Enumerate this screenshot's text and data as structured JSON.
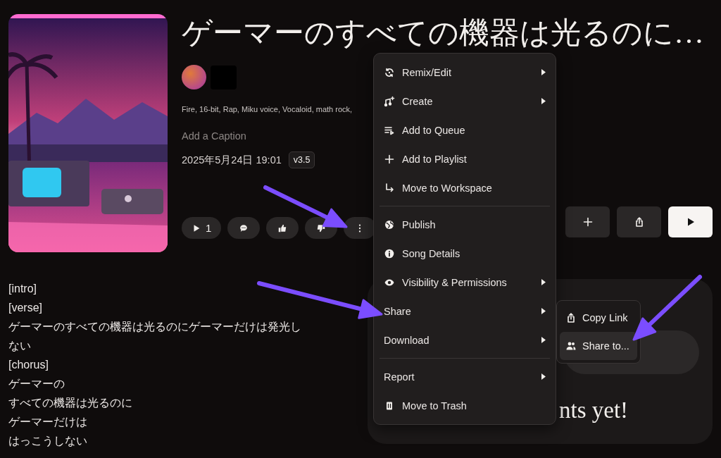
{
  "song": {
    "title": "ゲーマーのすべての機器は光るのに…",
    "tags": "Fire, 16-bit, Rap, Miku voice, Vocaloid, math rock,",
    "caption_prompt": "Add a Caption",
    "date": "2025年5月24日 19:01",
    "version": "v3.5"
  },
  "actions": [
    {
      "kind": "play",
      "label": "1"
    },
    {
      "kind": "comment"
    },
    {
      "kind": "like"
    },
    {
      "kind": "dislike"
    },
    {
      "kind": "more"
    }
  ],
  "right_buttons": [
    {
      "kind": "add"
    },
    {
      "kind": "share"
    },
    {
      "kind": "play"
    }
  ],
  "lyrics": [
    "[intro]",
    "[verse]",
    "ゲーマーのすべての機器は光るのにゲーマーだけは発光しない",
    "[chorus]",
    "ゲーマーの",
    "すべての機器は光るのに",
    "ゲーマーだけは",
    "はっこうしない"
  ],
  "comments": {
    "empty_text": "nts yet!"
  },
  "menu": {
    "sections": [
      [
        {
          "label": "Remix/Edit",
          "kind": "remix",
          "submenu": true
        },
        {
          "label": "Create",
          "kind": "create",
          "submenu": true
        },
        {
          "label": "Add to Queue",
          "kind": "queue",
          "submenu": false
        },
        {
          "label": "Add to Playlist",
          "kind": "plus",
          "submenu": false
        },
        {
          "label": "Move to Workspace",
          "kind": "move",
          "submenu": false
        }
      ],
      [
        {
          "label": "Publish",
          "kind": "globe",
          "submenu": false
        },
        {
          "label": "Song Details",
          "kind": "info",
          "submenu": false
        },
        {
          "label": "Visibility & Permissions",
          "kind": "eye",
          "submenu": true
        },
        {
          "label": "Share",
          "kind": "text",
          "submenu": true
        },
        {
          "label": "Download",
          "kind": "text",
          "submenu": true
        }
      ],
      [
        {
          "label": "Report",
          "kind": "text",
          "submenu": true
        },
        {
          "label": "Move to Trash",
          "kind": "trash",
          "submenu": false
        }
      ]
    ]
  },
  "submenu": [
    {
      "label": "Copy Link",
      "kind": "share",
      "selected": false
    },
    {
      "label": "Share to...",
      "kind": "people",
      "selected": true
    }
  ]
}
